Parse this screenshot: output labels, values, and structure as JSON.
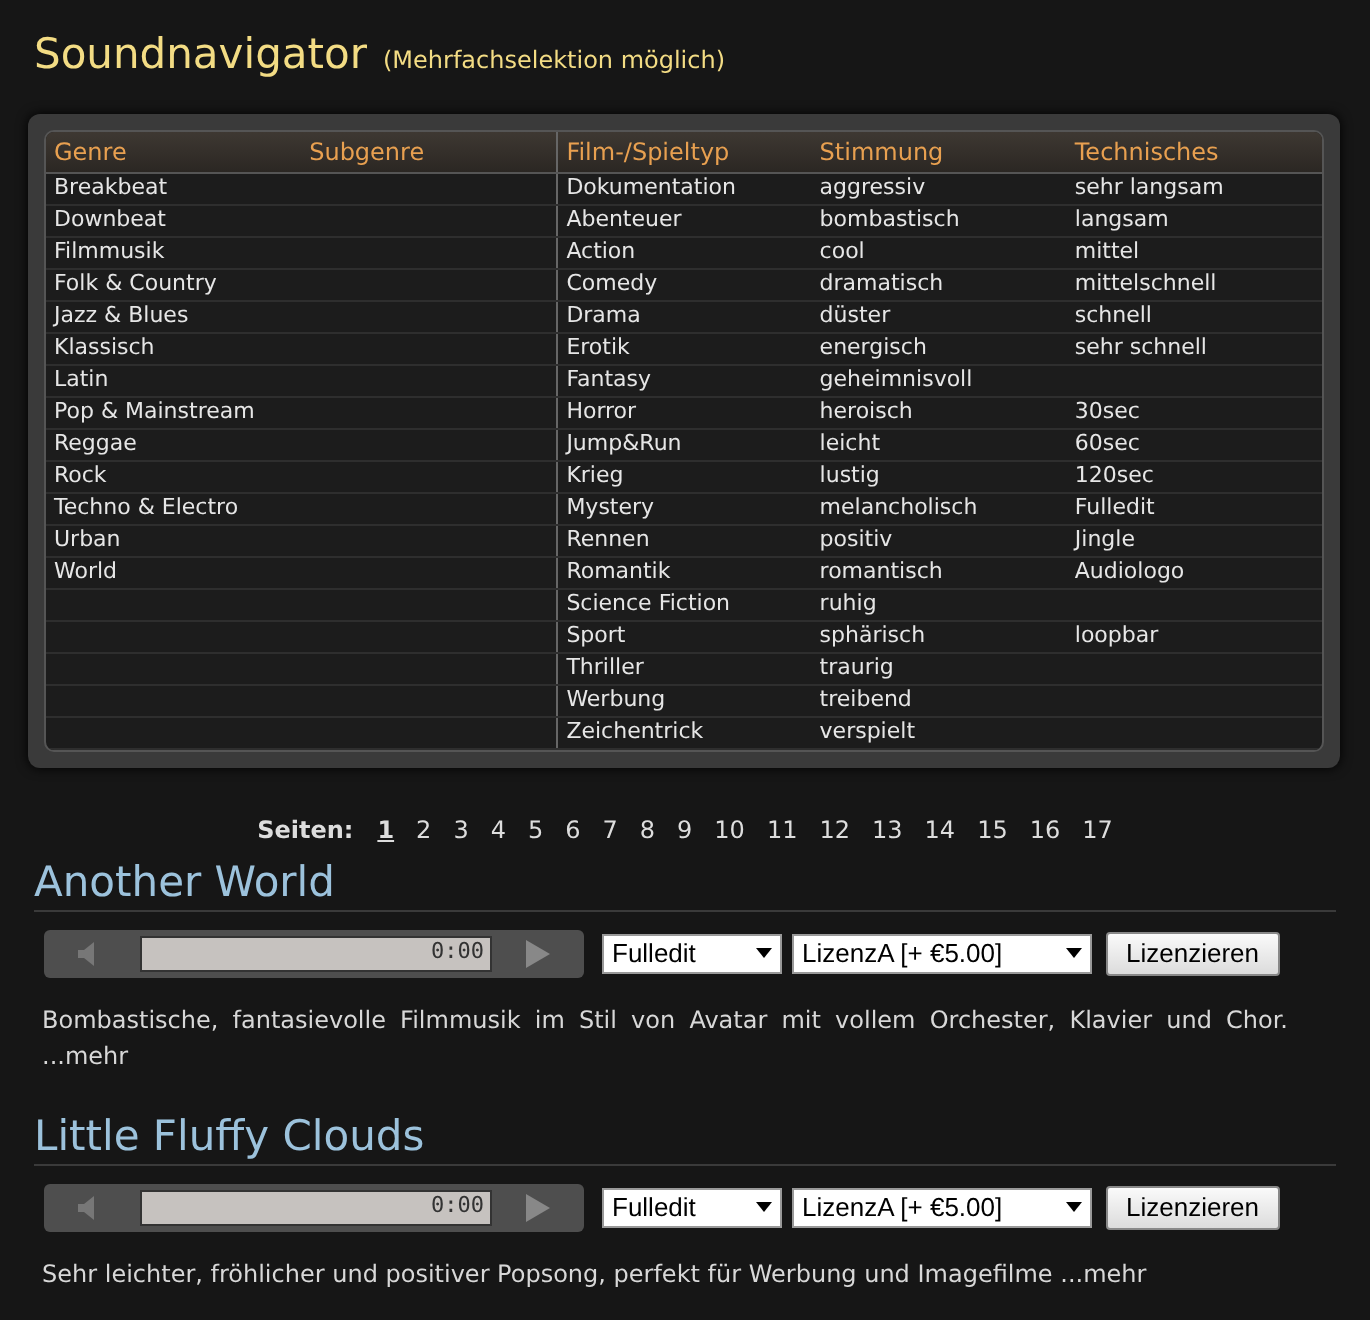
{
  "header": {
    "title": "Soundnavigator",
    "hint": "(Mehrfachselektion möglich)"
  },
  "navigator": {
    "columns": [
      "Genre",
      "Subgenre",
      "Film-/Spieltyp",
      "Stimmung",
      "Technisches"
    ],
    "rows": [
      {
        "genre": "Breakbeat",
        "film": "Dokumentation",
        "stimmung": "aggressiv",
        "technisches": "sehr langsam"
      },
      {
        "genre": "Downbeat",
        "film": "Abenteuer",
        "stimmung": "bombastisch",
        "technisches": "langsam"
      },
      {
        "genre": "Filmmusik",
        "film": "Action",
        "stimmung": "cool",
        "technisches": "mittel"
      },
      {
        "genre": "Folk & Country",
        "film": "Comedy",
        "stimmung": "dramatisch",
        "technisches": "mittelschnell"
      },
      {
        "genre": "Jazz & Blues",
        "film": "Drama",
        "stimmung": "düster",
        "technisches": "schnell"
      },
      {
        "genre": "Klassisch",
        "film": "Erotik",
        "stimmung": "energisch",
        "technisches": "sehr schnell"
      },
      {
        "genre": "Latin",
        "film": "Fantasy",
        "stimmung": "geheimnisvoll"
      },
      {
        "genre": "Pop & Mainstream",
        "film": "Horror",
        "stimmung": "heroisch",
        "technisches": "30sec"
      },
      {
        "genre": "Reggae",
        "film": "Jump&Run",
        "stimmung": "leicht",
        "technisches": "60sec"
      },
      {
        "genre": "Rock",
        "film": "Krieg",
        "stimmung": "lustig",
        "technisches": "120sec"
      },
      {
        "genre": "Techno & Electro",
        "film": "Mystery",
        "stimmung": "melancholisch",
        "technisches": "Fulledit"
      },
      {
        "genre": "Urban",
        "film": "Rennen",
        "stimmung": "positiv",
        "technisches": "Jingle"
      },
      {
        "genre": "World",
        "film": "Romantik",
        "stimmung": "romantisch",
        "technisches": "Audiologo"
      },
      {
        "film": "Science Fiction",
        "stimmung": "ruhig"
      },
      {
        "film": "Sport",
        "stimmung": "sphärisch",
        "technisches": "loopbar"
      },
      {
        "film": "Thriller",
        "stimmung": "traurig"
      },
      {
        "film": "Werbung",
        "stimmung": "treibend"
      },
      {
        "film": "Zeichentrick",
        "stimmung": "verspielt"
      }
    ]
  },
  "pagination": {
    "label": "Seiten:",
    "pages": [
      {
        "label": "1",
        "selected": true
      },
      {
        "label": "2",
        "selected": false
      },
      {
        "label": "3",
        "selected": false
      },
      {
        "label": "4",
        "selected": false
      },
      {
        "label": "5",
        "selected": false
      },
      {
        "label": "6",
        "selected": false
      },
      {
        "label": "7",
        "selected": false
      },
      {
        "label": "8",
        "selected": false
      },
      {
        "label": "9",
        "selected": false
      },
      {
        "label": "10",
        "selected": false
      },
      {
        "label": "11",
        "selected": false
      },
      {
        "label": "12",
        "selected": false
      },
      {
        "label": "13",
        "selected": false
      },
      {
        "label": "14",
        "selected": false
      },
      {
        "label": "15",
        "selected": false
      },
      {
        "label": "16",
        "selected": false
      },
      {
        "label": "17",
        "selected": false
      }
    ]
  },
  "tracks": [
    {
      "title": "Another World",
      "level": 0,
      "time": "0:00",
      "version": "Fulledit",
      "license": "LizenzA [+ €5.00]",
      "button": "Lizenzieren",
      "description": "Bombastische, fantasievolle Filmmusik im Stil von Avatar mit vollem Orchester, Klavier und Chor.",
      "more": "...mehr"
    },
    {
      "title": "Little Fluffy Clouds",
      "level": 0,
      "time": "0:00",
      "version": "Fulledit",
      "license": "LizenzA [+ €5.00]",
      "button": "Lizenzieren",
      "description": "Sehr leichter, fröhlicher und positiver Popsong, perfekt für Werbung und Imagefilme",
      "more": "...mehr"
    }
  ]
}
